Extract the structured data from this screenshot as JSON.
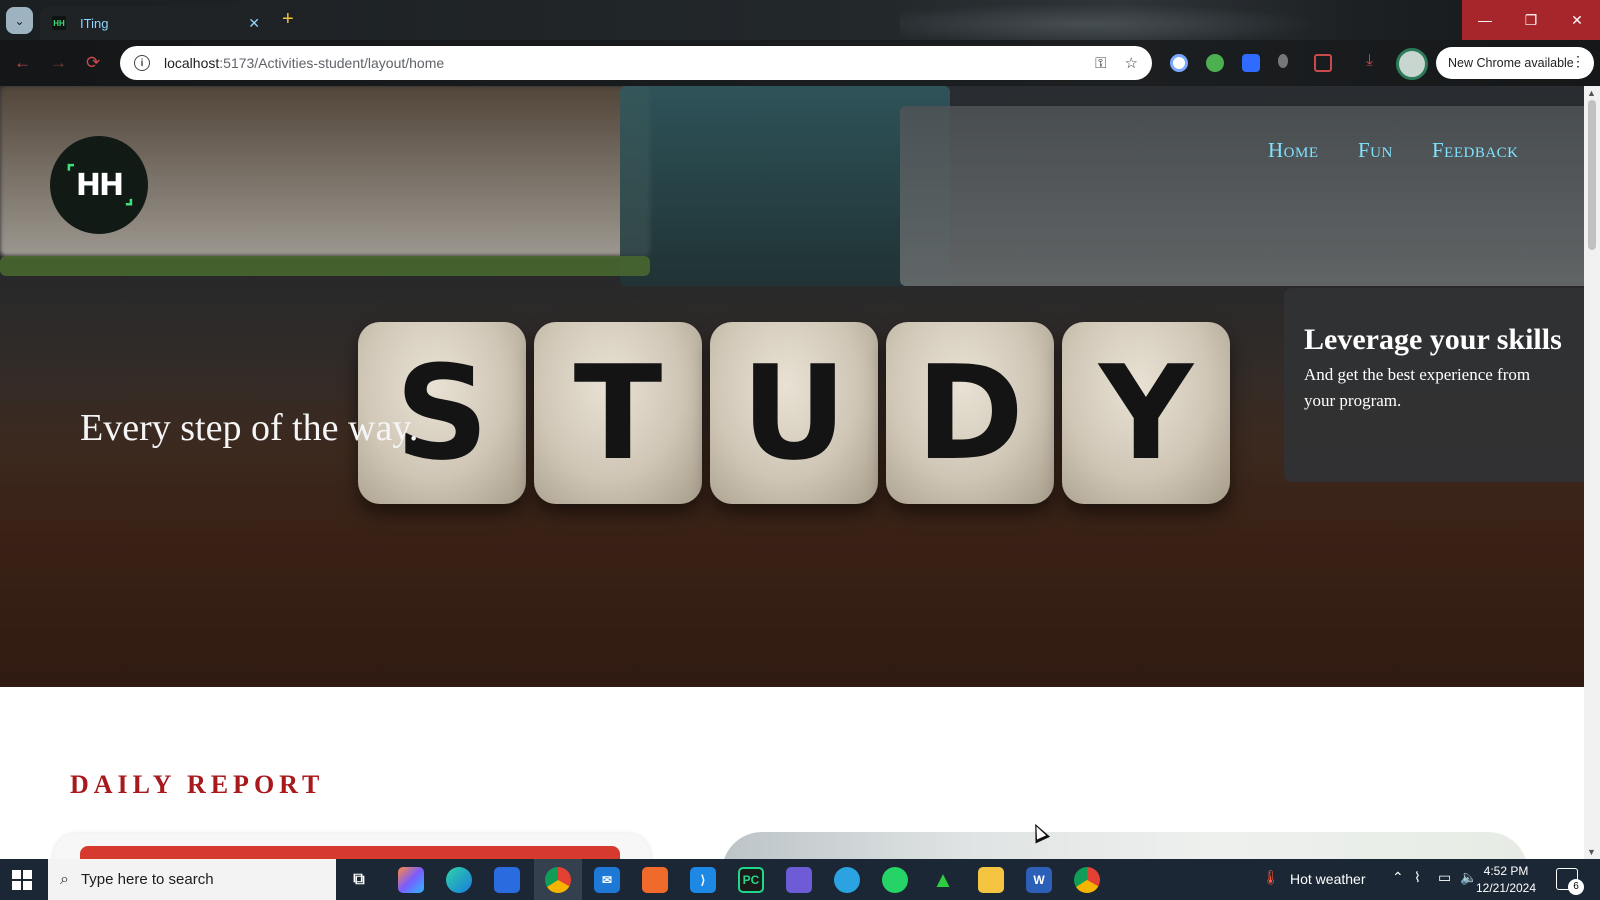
{
  "browser": {
    "tab_title": "ITing",
    "tab_close": "✕",
    "new_tab": "+",
    "url_host": "localhost",
    "url_path": ":5173/Activities-student/layout/home",
    "update_label": "New Chrome available",
    "window_controls": {
      "minimize": "—",
      "maximize": "❐",
      "close": "✕"
    },
    "nav": {
      "back": "←",
      "forward": "→",
      "reload": "⟳"
    }
  },
  "page": {
    "logo_text": "HH",
    "nav_items": [
      "Home",
      "Fun",
      "Feedback"
    ],
    "dice_letters": [
      "S",
      "T",
      "U",
      "D",
      "Y"
    ],
    "tagline": "Every step of the way.",
    "promo": {
      "title": "Leverage your skills",
      "text": "And get the best experience from your program."
    },
    "section_title": "DAILY REPORT"
  },
  "taskbar": {
    "search_placeholder": "Type here to search",
    "weather": "Hot weather",
    "time": "4:52 PM",
    "date": "12/21/2024",
    "notification_count": "6"
  },
  "colors": {
    "accent_nav": "#7fe3ff",
    "section_red": "#a7191c",
    "logo_green": "#3ee07a",
    "window_close_red": "#a6262b"
  },
  "icons": [
    "search-icon",
    "info-icon",
    "key-icon",
    "star-icon",
    "extension-icon",
    "download-icon",
    "windows-start-icon"
  ]
}
